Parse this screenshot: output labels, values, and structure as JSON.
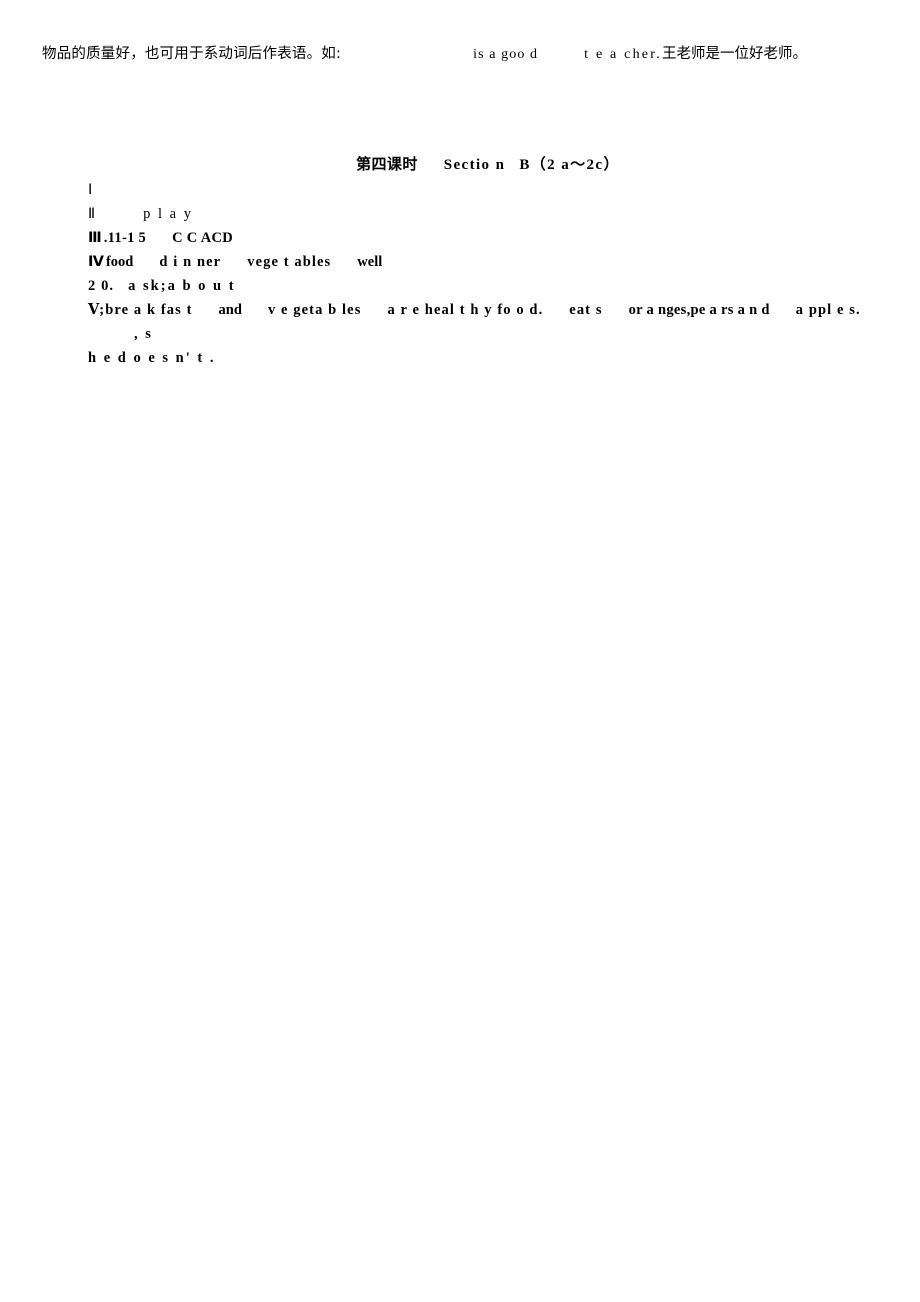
{
  "document": {
    "top_note": {
      "chinese_lead": "物品的质量好，也可用于系动词后作表语。如:",
      "english_fragment_1": "is a goo d",
      "english_fragment_2": "t e a cher.",
      "chinese_tail": "王老师是一位好老师。"
    },
    "section_title": {
      "lesson_label": "第四课时",
      "section_label": "Sectio n",
      "section_letter": "B（2 a～2c）"
    },
    "answer_key": {
      "lines": [
        {
          "numeral": "Ⅰ",
          "content": ""
        },
        {
          "numeral": "Ⅱ",
          "content": "p l a y"
        },
        {
          "numeral": "Ⅲ",
          "range": ".11-1 5",
          "content": "C C ACD"
        },
        {
          "numeral": "Ⅳ",
          "content": "food",
          "word_2": "d i n ner",
          "word_3": "vege t ables",
          "word_4": "well"
        },
        {
          "numeral": "",
          "item_number": "2 0.",
          "content": "a sk;a b o u t"
        }
      ],
      "final": {
        "numeral": "Ⅴ",
        "part_1": ";bre a k fas t",
        "part_2": "and",
        "part_3": "v e geta b les",
        "part_4": "a r e heal t h y fo o d.",
        "part_5": "eat s",
        "part_6": "or a nges,pe a rs a n d",
        "part_7": "a ppl e s.",
        "part_8": ", s",
        "part_9": "h e d o e s n' t ."
      }
    }
  }
}
